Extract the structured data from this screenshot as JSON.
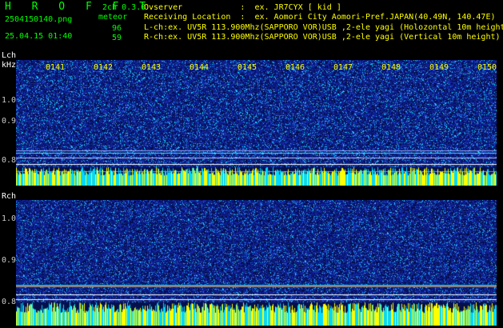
{
  "header": {
    "app_title": "H R O F F T",
    "filename": "2504150140.png",
    "timestamp": "25.04.15 01:40",
    "version": "2ch 0.3.0",
    "mode": "meteor",
    "count_l": "96",
    "count_r": "59"
  },
  "info": {
    "observer": "Ovserver            :  ex. JR7CYX [ kid ]",
    "location": "Receiving Location  :  ex. Aomori City Aomori-Pref.JAPAN(40.49N, 140.47E)",
    "lch": "L-ch:ex. UV5R 113.900Mhz(SAPPORO VOR)USB ,2-ele yagi (Holozontal 10m height)",
    "rch": "R-ch:ex. UV5R 113.900Mhz(SAPPORO VOR)USB ,2-ele yagi (Vertical 10m height)"
  },
  "lch": {
    "label": "Lch",
    "unit": "kHz",
    "y_labels": [
      "1.0",
      "0.9",
      "0.8"
    ]
  },
  "rch": {
    "label": "Rch",
    "y_labels": [
      "1.0",
      "0.9",
      "0.8"
    ]
  },
  "time_ticks": [
    "0141",
    "0142",
    "0143",
    "0144",
    "0145",
    "0146",
    "0147",
    "0148",
    "0149",
    "0150"
  ],
  "colors": {
    "background": "#000000",
    "noise_blue": "#1a2a9a",
    "noise_cyan": "#20c8ff",
    "level_yellow": "#ffff00",
    "level_cyan": "#00d8ff",
    "header_green": "#00ff00",
    "info_yellow": "#ffff00"
  }
}
